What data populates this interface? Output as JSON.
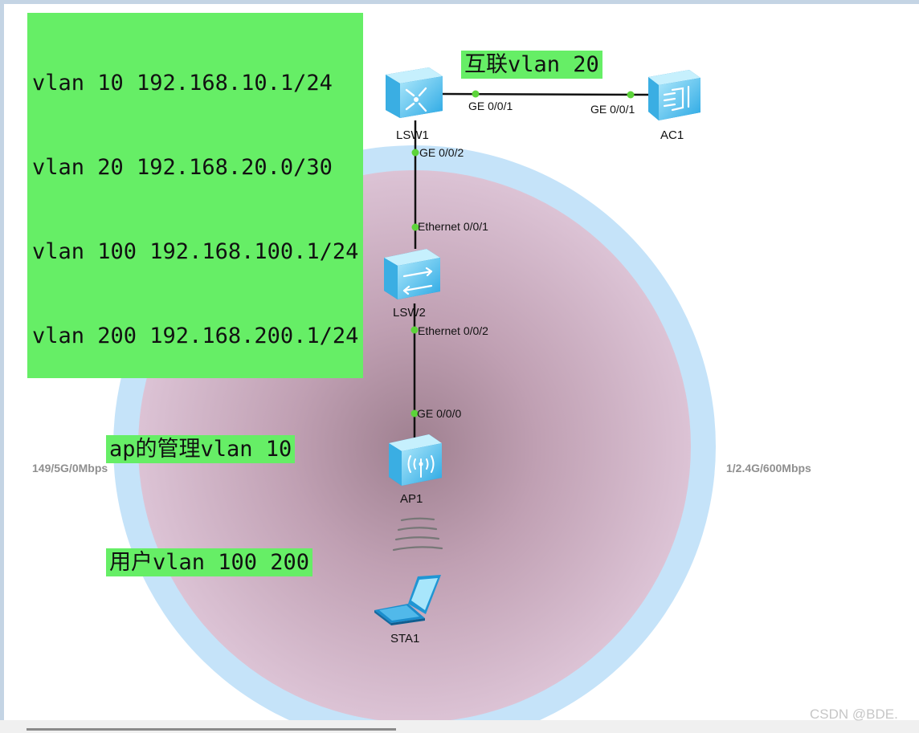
{
  "annotations": {
    "ip_lines": [
      "vlan 10 192.168.10.1/24",
      "vlan 20 192.168.20.0/30",
      "vlan 100 192.168.100.1/24",
      "vlan 200 192.168.200.1/24"
    ],
    "interconnect": "互联vlan 20",
    "ap_mgmt": "ap的管理vlan 10",
    "user_vlan": "用户vlan 100 200"
  },
  "devices": {
    "lsw1": {
      "name": "LSW1",
      "icon": "core-switch-icon"
    },
    "ac1": {
      "name": "AC1",
      "icon": "access-controller-icon"
    },
    "lsw2": {
      "name": "LSW2",
      "icon": "switch-icon"
    },
    "ap1": {
      "name": "AP1",
      "icon": "access-point-icon"
    },
    "sta1": {
      "name": "STA1",
      "icon": "laptop-icon"
    }
  },
  "ports": {
    "lsw1_to_ac1": "GE 0/0/1",
    "ac1_to_lsw1": "GE 0/0/1",
    "lsw1_to_lsw2": "GE 0/0/2",
    "lsw2_to_lsw1": "Ethernet 0/0/1",
    "lsw2_to_ap1": "Ethernet 0/0/2",
    "ap1_to_lsw2": "GE 0/0/0"
  },
  "radio": {
    "left": "149/5G/0Mbps",
    "right": "1/2.4G/600Mbps"
  },
  "watermark": "CSDN @BDE.",
  "colors": {
    "note_bg": "#66ee66",
    "coverage_outer": "#c5e3f9",
    "coverage_inner": "#d8bcd0",
    "port_dot": "#5cd43a"
  }
}
